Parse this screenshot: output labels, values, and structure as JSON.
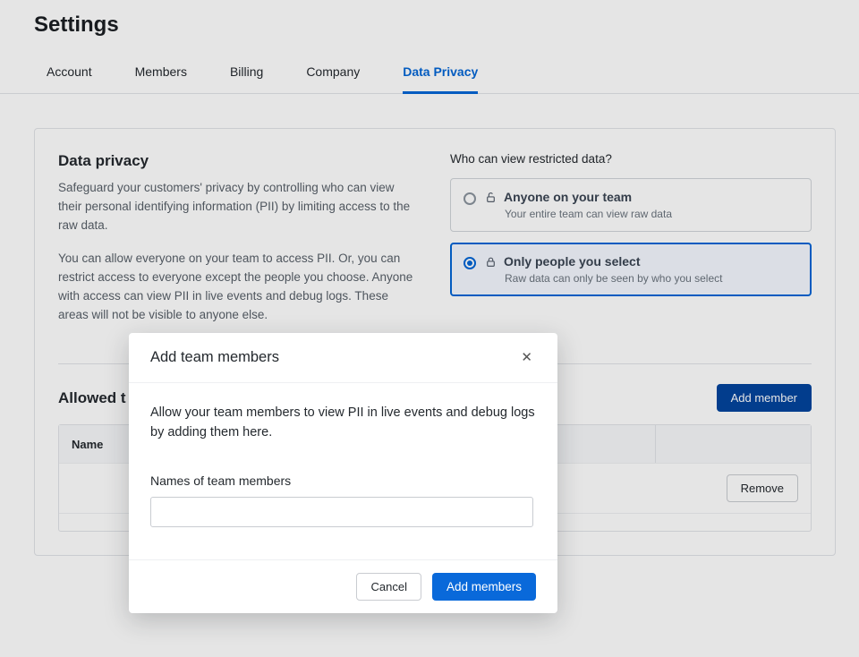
{
  "page": {
    "title": "Settings"
  },
  "tabs": [
    {
      "label": "Account",
      "active": false
    },
    {
      "label": "Members",
      "active": false
    },
    {
      "label": "Billing",
      "active": false
    },
    {
      "label": "Company",
      "active": false
    },
    {
      "label": "Data Privacy",
      "active": true
    }
  ],
  "privacy": {
    "heading": "Data privacy",
    "para1": "Safeguard your customers' privacy by controlling who can view their personal identifying information (PII) by limiting access to the raw data.",
    "para2": "You can allow everyone on your team to access PII. Or, you can restrict access to everyone except the people you choose. Anyone with access can view PII in live events and debug logs. These areas will not be visible to anyone else.",
    "question": "Who can view restricted data?",
    "options": [
      {
        "title": "Anyone on your team",
        "sub": "Your entire team can view raw data",
        "selected": false,
        "icon": "unlock"
      },
      {
        "title": "Only people you select",
        "sub": "Raw data can only be seen by who you select",
        "selected": true,
        "icon": "lock"
      }
    ]
  },
  "allowed": {
    "heading_visible": "Allowed t",
    "add_button": "Add member",
    "columns": {
      "name": "Name"
    },
    "rows": [
      {
        "remove_label": "Remove"
      }
    ]
  },
  "modal": {
    "title": "Add team members",
    "description": "Allow your team members to view PII in live events and debug logs by adding them here.",
    "field_label": "Names of team members",
    "input_value": "",
    "cancel": "Cancel",
    "submit": "Add members"
  }
}
